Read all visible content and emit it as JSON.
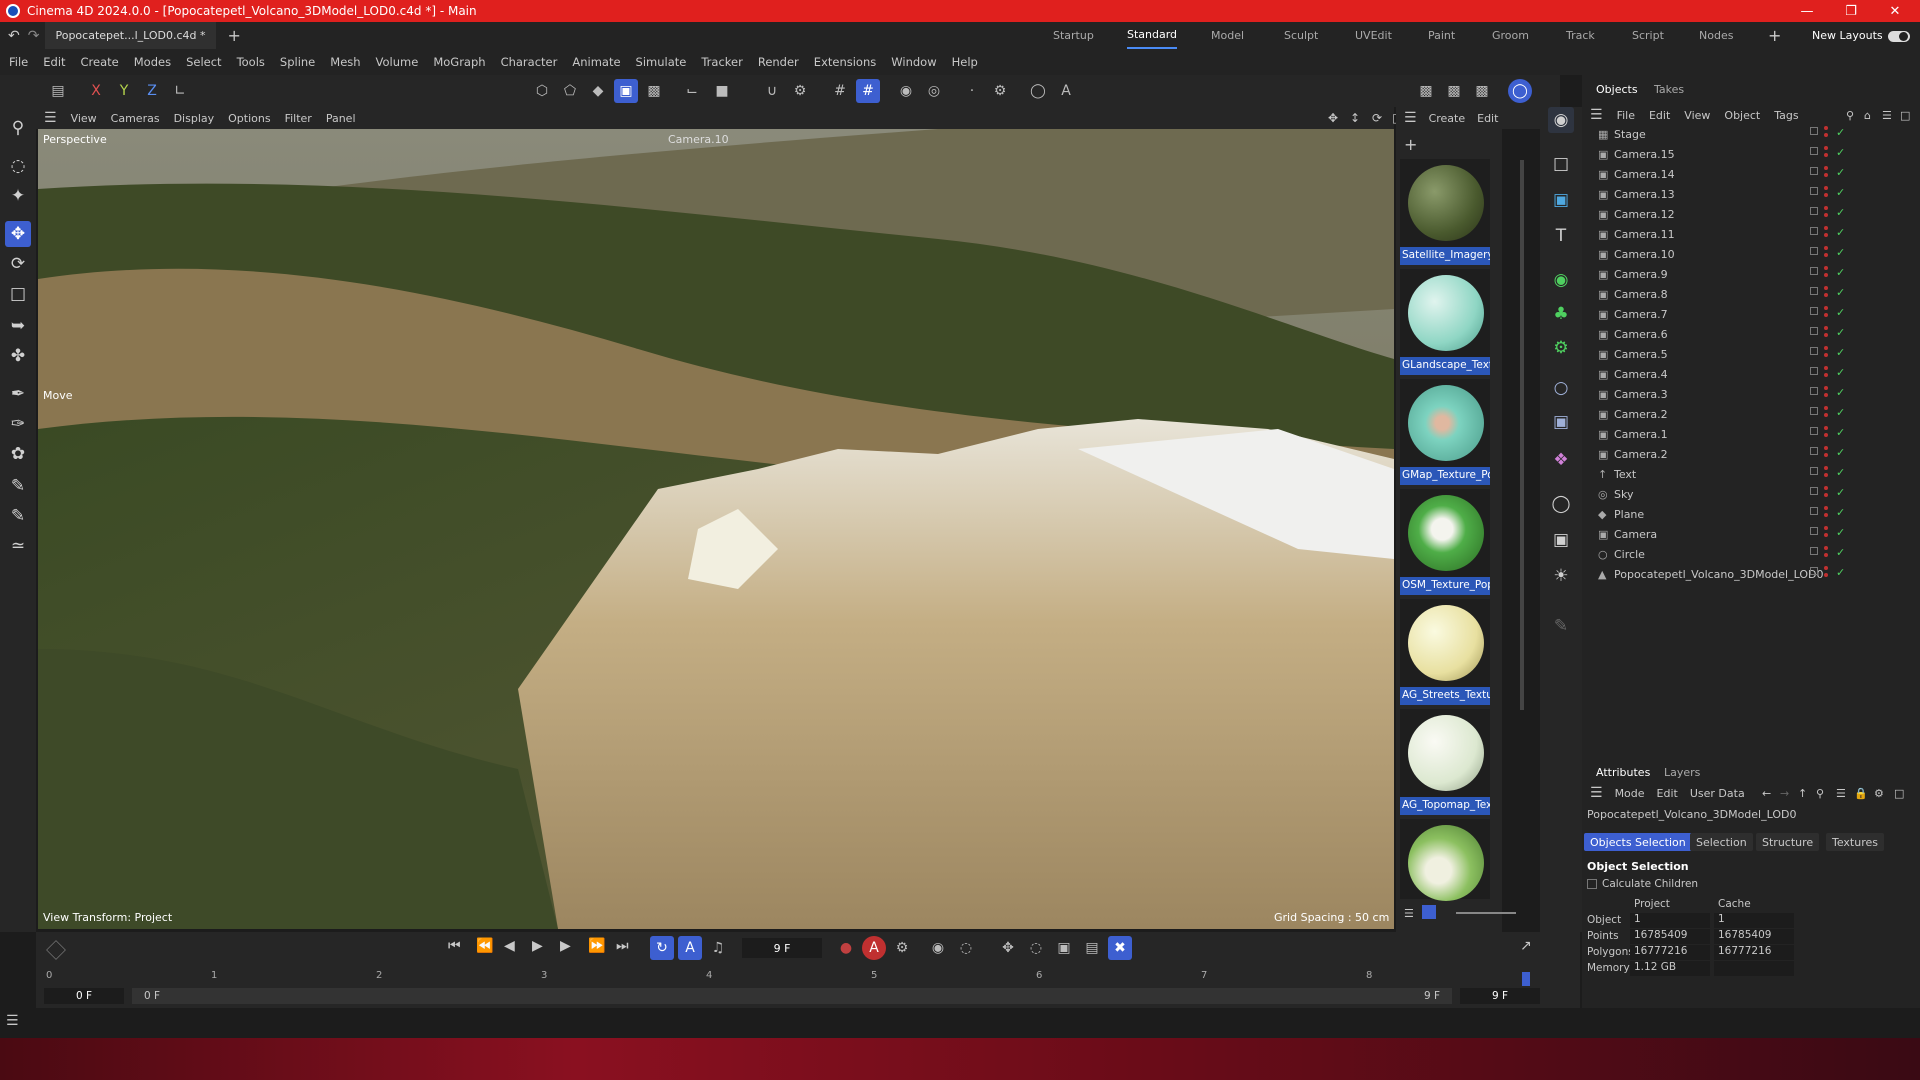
{
  "app": {
    "title": "Cinema 4D 2024.0.0 - [Popocatepetl_Volcano_3DModel_LOD0.c4d *] - Main"
  },
  "tabs": {
    "document": "Popocatepet...l_LOD0.c4d *",
    "layouts": [
      "Startup",
      "Standard",
      "Model",
      "Sculpt",
      "UVEdit",
      "Paint",
      "Groom",
      "Track",
      "Script",
      "Nodes"
    ],
    "active_layout": "Standard",
    "new_layouts": "New Layouts"
  },
  "menu": [
    "File",
    "Edit",
    "Create",
    "Modes",
    "Select",
    "Tools",
    "Spline",
    "Mesh",
    "Volume",
    "MoGraph",
    "Character",
    "Animate",
    "Simulate",
    "Tracker",
    "Render",
    "Extensions",
    "Window",
    "Help"
  ],
  "toolbar": {
    "axis_x": "X",
    "axis_y": "Y",
    "axis_z": "Z"
  },
  "viewport": {
    "menu": [
      "View",
      "Cameras",
      "Display",
      "Options",
      "Filter",
      "Panel"
    ],
    "name": "Perspective",
    "camera": "Camera.10",
    "tool_label": "Move",
    "view_transform": "View Transform: Project",
    "grid_spacing": "Grid Spacing : 50 cm"
  },
  "materials": {
    "menu": [
      "Create",
      "Edit"
    ],
    "items": [
      {
        "name": "Satellite_Imagery_",
        "color": "#4a5a2e"
      },
      {
        "name": "GLandscape_Textu",
        "color": "#8fd6c4"
      },
      {
        "name": "GMap_Texture_Po",
        "color": "#7dd3c0"
      },
      {
        "name": "OSM_Texture_Pop",
        "color": "#4fae48"
      },
      {
        "name": "AG_Streets_Textur",
        "color": "#e8e0a0"
      },
      {
        "name": "AG_Topomap_Text",
        "color": "#dce8d0"
      },
      {
        "name": "",
        "color": "#8cc060"
      }
    ]
  },
  "objects": {
    "tabs": [
      "Objects",
      "Takes"
    ],
    "menu": [
      "File",
      "Edit",
      "View",
      "Object",
      "Tags"
    ],
    "items": [
      {
        "name": "Stage",
        "icon": "stage-icon"
      },
      {
        "name": "Camera.15",
        "icon": "camera-icon"
      },
      {
        "name": "Camera.14",
        "icon": "camera-icon"
      },
      {
        "name": "Camera.13",
        "icon": "camera-icon"
      },
      {
        "name": "Camera.12",
        "icon": "camera-icon"
      },
      {
        "name": "Camera.11",
        "icon": "camera-icon"
      },
      {
        "name": "Camera.10",
        "icon": "camera-icon"
      },
      {
        "name": "Camera.9",
        "icon": "camera-icon"
      },
      {
        "name": "Camera.8",
        "icon": "camera-icon"
      },
      {
        "name": "Camera.7",
        "icon": "camera-icon"
      },
      {
        "name": "Camera.6",
        "icon": "camera-icon"
      },
      {
        "name": "Camera.5",
        "icon": "camera-icon"
      },
      {
        "name": "Camera.4",
        "icon": "camera-icon"
      },
      {
        "name": "Camera.3",
        "icon": "camera-icon"
      },
      {
        "name": "Camera.2",
        "icon": "camera-icon"
      },
      {
        "name": "Camera.1",
        "icon": "camera-icon"
      },
      {
        "name": "Camera.2",
        "icon": "camera-icon"
      },
      {
        "name": "Text",
        "icon": "text-icon"
      },
      {
        "name": "Sky",
        "icon": "sky-icon"
      },
      {
        "name": "Plane",
        "icon": "plane-icon"
      },
      {
        "name": "Camera",
        "icon": "camera-icon"
      },
      {
        "name": "Circle",
        "icon": "circle-icon"
      },
      {
        "name": "Popocatepetl_Volcano_3DModel_LOD0",
        "icon": "polygon-object-icon"
      }
    ]
  },
  "attributes": {
    "tabs": [
      "Attributes",
      "Layers"
    ],
    "menu": [
      "Mode",
      "Edit",
      "User Data"
    ],
    "object_name": "Popocatepetl_Volcano_3DModel_LOD0",
    "subtabs": [
      "Objects Selection",
      "Selection",
      "Structure",
      "Textures"
    ],
    "active_subtab": "Objects Selection",
    "section": "Object Selection",
    "calc_children": "Calculate Children",
    "col_project": "Project",
    "col_cache": "Cache",
    "rows": [
      {
        "label": "Object",
        "project": "1",
        "cache": "1"
      },
      {
        "label": "Points",
        "project": "16785409",
        "cache": "16785409"
      },
      {
        "label": "Polygons",
        "project": "16777216",
        "cache": "16777216"
      },
      {
        "label": "Memory",
        "project": "1.12 GB",
        "cache": ""
      }
    ]
  },
  "timeline": {
    "current_frame": "9 F",
    "ticks": [
      "0",
      "1",
      "2",
      "3",
      "4",
      "5",
      "6",
      "7",
      "8"
    ],
    "start": "0 F",
    "start2": "0 F",
    "end": "9 F",
    "end2": "9 F"
  },
  "colors": {
    "accent": "#3d5fd0",
    "titlebar": "#e0201e"
  }
}
